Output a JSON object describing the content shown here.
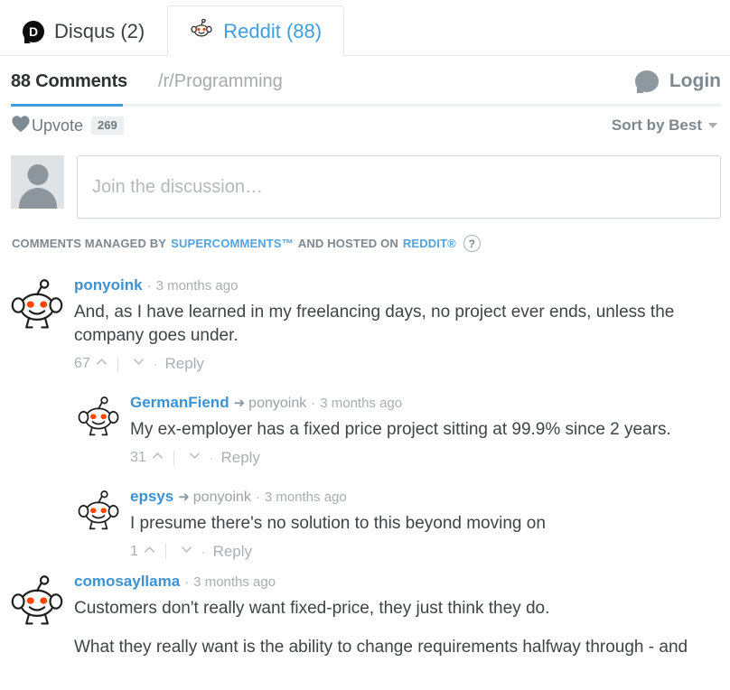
{
  "tabs": [
    {
      "id": "disqus",
      "label": "Disqus (2)",
      "icon": "disqus-icon",
      "active": false
    },
    {
      "id": "reddit",
      "label": "Reddit (88)",
      "icon": "reddit-snoo-icon",
      "active": true
    }
  ],
  "header": {
    "comments_count_label": "88 Comments",
    "subreddit": "/r/Programming",
    "login_label": "Login",
    "login_icon": "speech-bubble-icon"
  },
  "subbar": {
    "upvote_label": "Upvote",
    "upvote_count": "269",
    "upvote_icon": "heart-icon",
    "sort_label": "Sort by Best",
    "sort_caret_icon": "caret-down-icon"
  },
  "composer": {
    "avatar_icon": "default-user-avatar",
    "placeholder": "Join the discussion…",
    "value": ""
  },
  "managed_by": {
    "prefix": "COMMENTS MANAGED BY",
    "service": "SUPERCOMMENTS™",
    "middle": "AND HOSTED ON",
    "host": "REDDIT®",
    "help_label": "?"
  },
  "comments": [
    {
      "user": "ponyoink",
      "parent": "",
      "time": "3 months ago",
      "paragraphs": [
        "And, as I have learned in my freelancing days, no project ever ends, unless the company goes under."
      ],
      "score": "67",
      "reply_label": "Reply",
      "nested": false
    },
    {
      "user": "GermanFiend",
      "parent": "ponyoink",
      "time": "3 months ago",
      "paragraphs": [
        "My ex-employer has a fixed price project sitting at 99.9% since 2 years."
      ],
      "score": "31",
      "reply_label": "Reply",
      "nested": true
    },
    {
      "user": "epsys",
      "parent": "ponyoink",
      "time": "3 months ago",
      "paragraphs": [
        "I presume there's no solution to this beyond moving on"
      ],
      "score": "1",
      "reply_label": "Reply",
      "nested": true
    },
    {
      "user": "comosayllama",
      "parent": "",
      "time": "3 months ago",
      "paragraphs": [
        "Customers don't really want fixed-price, they just think they do.",
        "What they really want is the ability to change requirements halfway through - and"
      ],
      "score": "",
      "reply_label": "",
      "nested": false
    }
  ],
  "colors": {
    "accent_blue": "#3f9ede",
    "link_blue": "#3d92d4",
    "muted_grey": "#7e888f",
    "snoo_eye_orange": "#ff4500"
  },
  "glyphs": {
    "arrow_right": "➜",
    "mid_dot": "·"
  }
}
